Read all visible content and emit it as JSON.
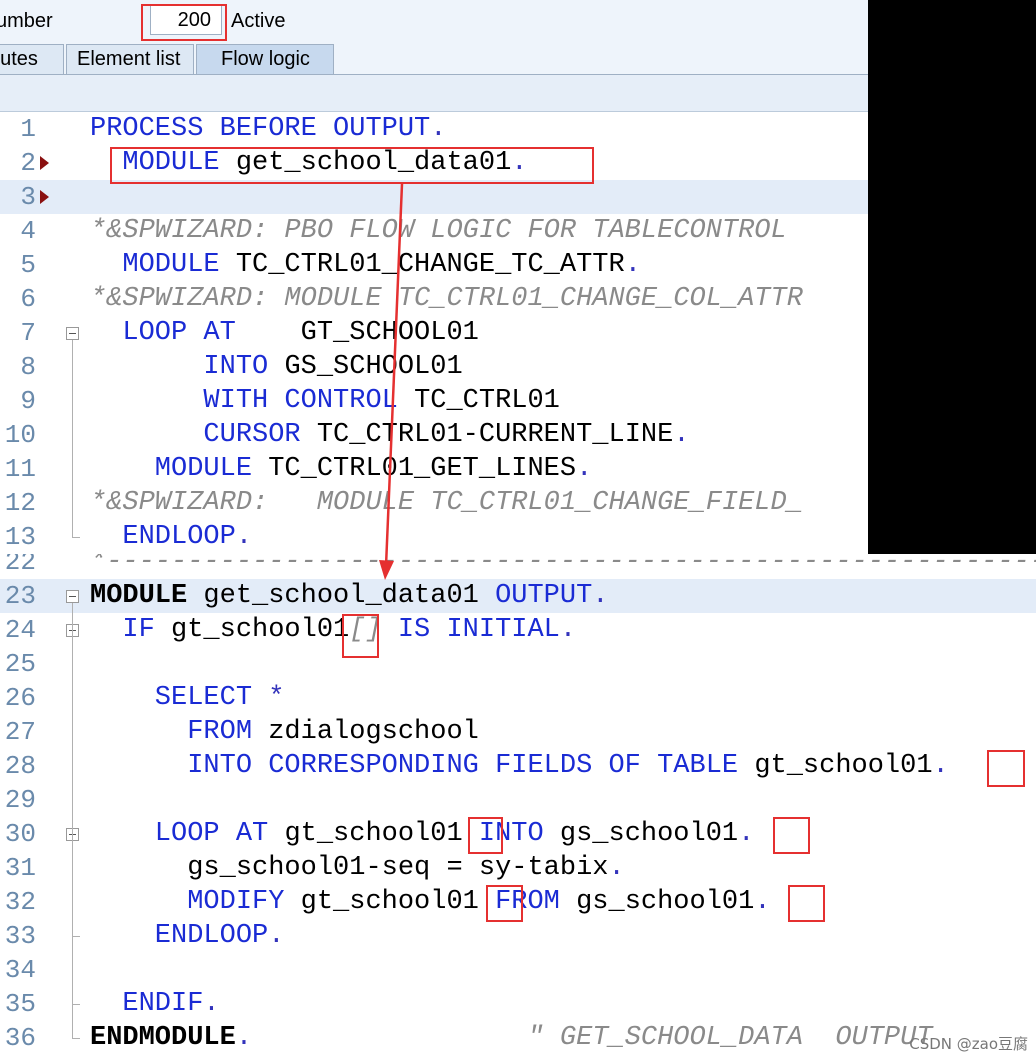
{
  "header": {
    "screen_number_label": "umber",
    "screen_number_value": "200",
    "status": "Active"
  },
  "tabs": [
    {
      "label": "putes",
      "active": false
    },
    {
      "label": "Element list",
      "active": false
    },
    {
      "label": "Flow logic",
      "active": true
    }
  ],
  "flow_logic": [
    {
      "n": "1",
      "tokens": [
        {
          "t": "PROCESS BEFORE OUTPUT",
          "c": "kw"
        },
        {
          "t": ".",
          "c": "pt"
        }
      ]
    },
    {
      "n": "2",
      "tokens": [
        {
          "t": "  MODULE ",
          "c": "kw"
        },
        {
          "t": "get_school_data01",
          "c": "tx"
        },
        {
          "t": ".",
          "c": "pt"
        }
      ]
    },
    {
      "n": "3",
      "tokens": []
    },
    {
      "n": "4",
      "tokens": [
        {
          "t": "*&SPWIZARD: PBO FLOW LOGIC FOR TABLECONTROL",
          "c": "cm"
        }
      ]
    },
    {
      "n": "5",
      "tokens": [
        {
          "t": "  MODULE ",
          "c": "kw"
        },
        {
          "t": "TC_CTRL01_CHANGE_TC_ATTR",
          "c": "tx"
        },
        {
          "t": ".",
          "c": "pt"
        }
      ]
    },
    {
      "n": "6",
      "tokens": [
        {
          "t": "*&SPWIZARD: MODULE TC_CTRL01_CHANGE_COL_ATTR",
          "c": "cm"
        }
      ]
    },
    {
      "n": "7",
      "tokens": [
        {
          "t": "  LOOP AT    ",
          "c": "kw"
        },
        {
          "t": "GT_SCHOOL01",
          "c": "tx"
        }
      ]
    },
    {
      "n": "8",
      "tokens": [
        {
          "t": "       INTO ",
          "c": "kw"
        },
        {
          "t": "GS_SCHOOL01",
          "c": "tx"
        }
      ]
    },
    {
      "n": "9",
      "tokens": [
        {
          "t": "       WITH CONTROL ",
          "c": "kw"
        },
        {
          "t": "TC_CTRL01",
          "c": "tx"
        }
      ]
    },
    {
      "n": "10",
      "tokens": [
        {
          "t": "       CURSOR ",
          "c": "kw"
        },
        {
          "t": "TC_CTRL01-CURRENT_LINE",
          "c": "tx"
        },
        {
          "t": ".",
          "c": "pt"
        }
      ]
    },
    {
      "n": "11",
      "tokens": [
        {
          "t": "    MODULE ",
          "c": "kw"
        },
        {
          "t": "TC_CTRL01_GET_LINES",
          "c": "tx"
        },
        {
          "t": ".",
          "c": "pt"
        }
      ]
    },
    {
      "n": "12",
      "tokens": [
        {
          "t": "*&SPWIZARD:   MODULE TC_CTRL01_CHANGE_FIELD_",
          "c": "cm"
        }
      ]
    },
    {
      "n": "13",
      "tokens": [
        {
          "t": "  ENDLOOP",
          "c": "kw"
        },
        {
          "t": ".",
          "c": "pt"
        }
      ]
    }
  ],
  "module_code": [
    {
      "n": "22",
      "tokens": [
        {
          "t": "*-----------------------------------------------------------",
          "c": "cm"
        }
      ]
    },
    {
      "n": "23",
      "tokens": [
        {
          "t": "MODULE ",
          "c": "kwb"
        },
        {
          "t": "get_school_data01 ",
          "c": "tx"
        },
        {
          "t": "OUTPUT",
          "c": "kw"
        },
        {
          "t": ".",
          "c": "pt"
        }
      ]
    },
    {
      "n": "24",
      "tokens": [
        {
          "t": "  IF ",
          "c": "kw"
        },
        {
          "t": "gt_school01",
          "c": "tx"
        },
        {
          "t": "[] ",
          "c": "cm"
        },
        {
          "t": "IS INITIAL",
          "c": "kw"
        },
        {
          "t": ".",
          "c": "pt"
        }
      ]
    },
    {
      "n": "25",
      "tokens": []
    },
    {
      "n": "26",
      "tokens": [
        {
          "t": "    SELECT ",
          "c": "kw"
        },
        {
          "t": "*",
          "c": "pt"
        }
      ]
    },
    {
      "n": "27",
      "tokens": [
        {
          "t": "      FROM ",
          "c": "kw"
        },
        {
          "t": "zdialogschool",
          "c": "tx"
        }
      ]
    },
    {
      "n": "28",
      "tokens": [
        {
          "t": "      INTO CORRESPONDING FIELDS OF TABLE ",
          "c": "kw"
        },
        {
          "t": "gt_school01",
          "c": "tx"
        },
        {
          "t": ".",
          "c": "pt"
        }
      ]
    },
    {
      "n": "29",
      "tokens": []
    },
    {
      "n": "30",
      "tokens": [
        {
          "t": "    LOOP AT ",
          "c": "kw"
        },
        {
          "t": "gt_school01 ",
          "c": "tx"
        },
        {
          "t": "INTO ",
          "c": "kw"
        },
        {
          "t": "gs_school01",
          "c": "tx"
        },
        {
          "t": ".",
          "c": "pt"
        }
      ]
    },
    {
      "n": "31",
      "tokens": [
        {
          "t": "      gs_school01-seq = sy-tabix",
          "c": "tx"
        },
        {
          "t": ".",
          "c": "pt"
        }
      ]
    },
    {
      "n": "32",
      "tokens": [
        {
          "t": "      MODIFY ",
          "c": "kw"
        },
        {
          "t": "gt_school01 ",
          "c": "tx"
        },
        {
          "t": "FROM ",
          "c": "kw"
        },
        {
          "t": "gs_school01",
          "c": "tx"
        },
        {
          "t": ".",
          "c": "pt"
        }
      ]
    },
    {
      "n": "33",
      "tokens": [
        {
          "t": "    ENDLOOP",
          "c": "kw"
        },
        {
          "t": ".",
          "c": "pt"
        }
      ]
    },
    {
      "n": "34",
      "tokens": []
    },
    {
      "n": "35",
      "tokens": [
        {
          "t": "  ENDIF",
          "c": "kw"
        },
        {
          "t": ".",
          "c": "pt"
        }
      ]
    },
    {
      "n": "36",
      "tokens": [
        {
          "t": "ENDMODULE",
          "c": "kwb"
        },
        {
          "t": ".",
          "c": "pt"
        },
        {
          "t": "                 \" GET_SCHOOL_DATA  OUTPUT",
          "c": "cm"
        }
      ]
    }
  ],
  "watermark": "CSDN @zao豆腐"
}
